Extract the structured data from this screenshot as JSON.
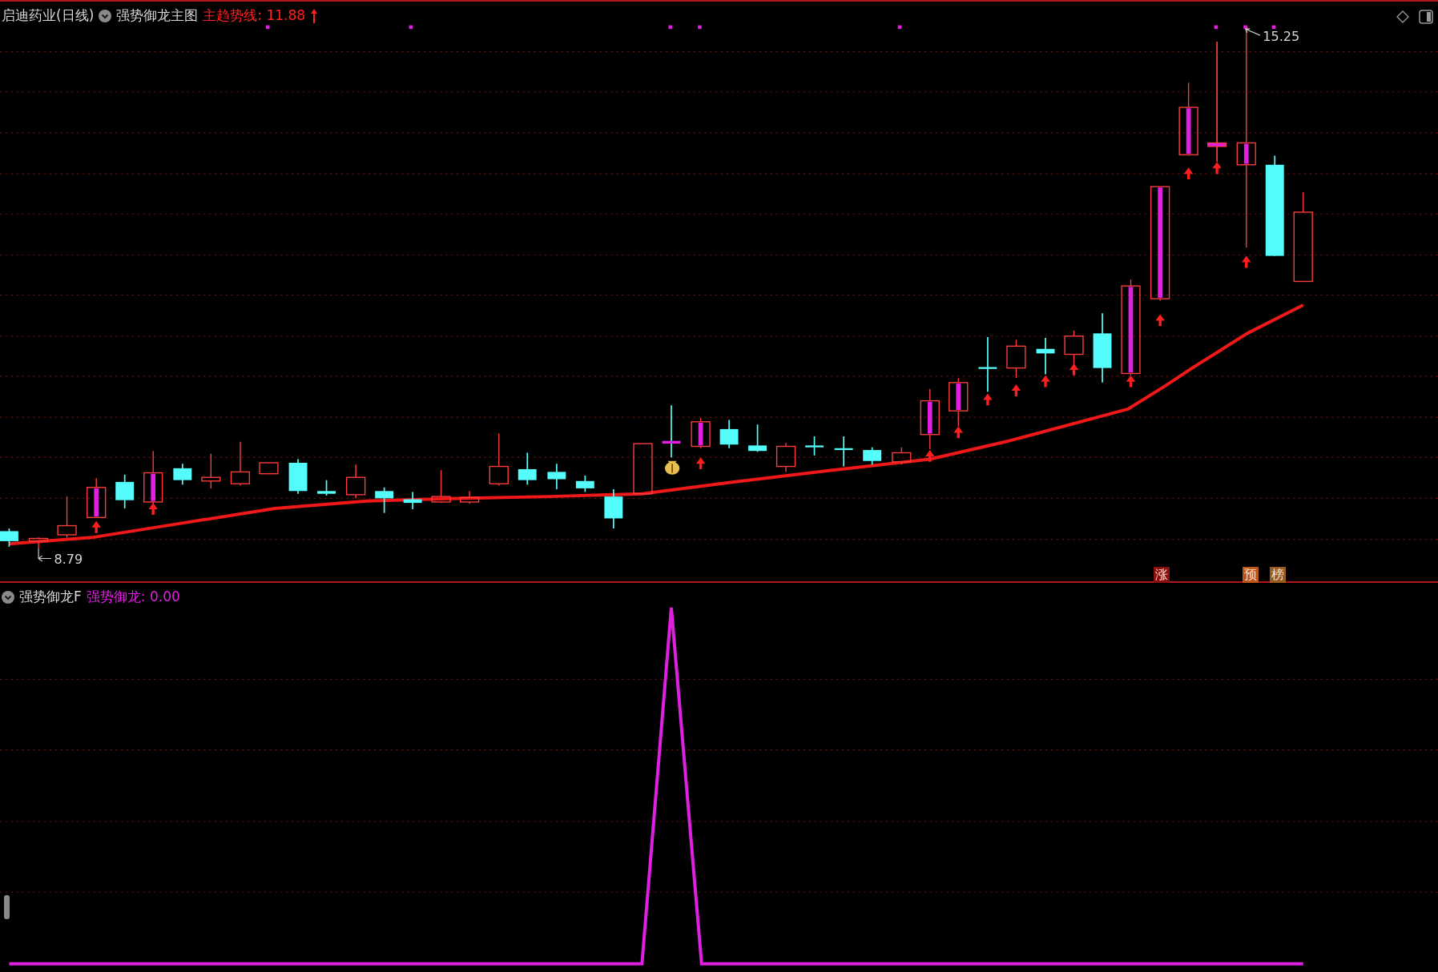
{
  "main_panel": {
    "title": "启迪药业(日线)",
    "indicator": "强势御龙主图",
    "trend_line": {
      "label": "主趋势线:",
      "value": "11.88"
    },
    "low_label": "8.79",
    "high_label": "15.25",
    "badges": [
      {
        "text": "涨",
        "color": "#8b0d0d"
      },
      {
        "text": "预",
        "color": "#c0551a"
      },
      {
        "text": "榜",
        "color": "#9a5a1e"
      }
    ]
  },
  "sub_panel": {
    "indicator": "强势御龙F",
    "line": {
      "label": "强势御龙:",
      "value": "0.00"
    }
  }
}
